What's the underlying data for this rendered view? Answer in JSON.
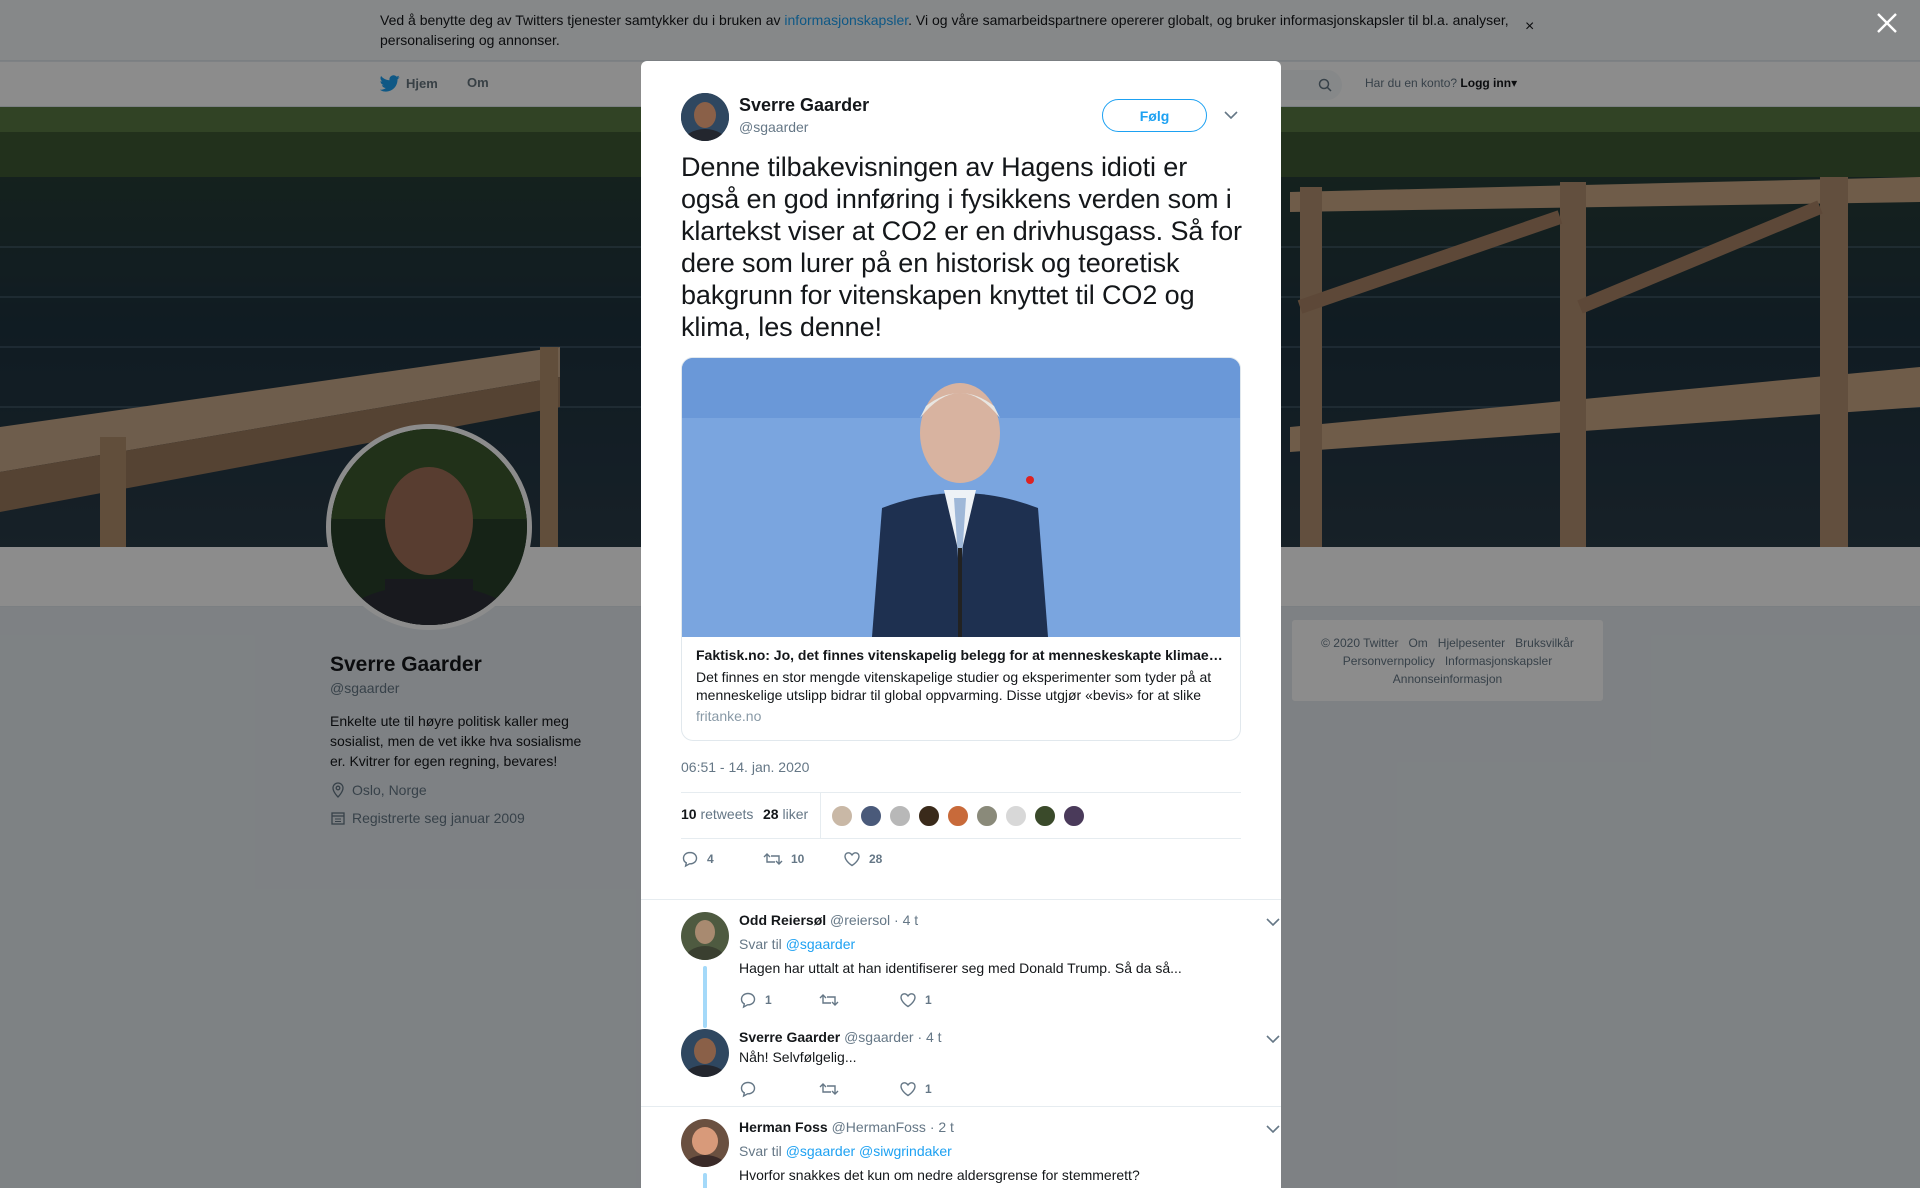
{
  "cookie_bar": {
    "text_before": "Ved å benytte deg av Twitters tjenester samtykker du i bruken av ",
    "link": "informasjonskapsler",
    "text_after": ". Vi og våre samarbeidspartnere opererer globalt, og bruker informasjonskapsler til bl.a. analyser, personalisering og annonser.",
    "close_icon": "×"
  },
  "nav": {
    "home": "Hjem",
    "about": "Om",
    "login_prompt": "Har du en konto?",
    "login": "Logg inn"
  },
  "profile": {
    "name": "Sverre Gaarder",
    "handle": "@sgaarder",
    "bio": "Enkelte ute til høyre politisk kaller meg sosialist, men de vet ikke hva sosialisme er. Kvitrer for egen regning, bevares!",
    "location": "Oslo, Norge",
    "joined": "Registrerte seg januar 2009"
  },
  "footer": {
    "links": [
      "© 2020 Twitter",
      "Om",
      "Hjelpesenter",
      "Bruksvilkår",
      "Personvernpolicy",
      "Informasjonskapsler",
      "Annonseinformasjon"
    ]
  },
  "tweet": {
    "author_name": "Sverre Gaarder",
    "author_handle": "@sgaarder",
    "follow_label": "Følg",
    "text": "Denne tilbakevisningen av Hagens idioti er også en god innføring i fysikkens verden som i klartekst viser at CO2 er en drivhusgass. Så for dere som lurer på en historisk og teoretisk bakgrunn for vitenskapen knyttet til CO2 og klima, les denne!",
    "card": {
      "title": "Faktisk.no: Jo, det finnes vitenskapelig belegg for at menneskeskapte klimaendringer",
      "description": "Det finnes en stor mengde vitenskapelige studier og eksperimenter som tyder på at menneskelige utslipp bidrar til global oppvarming. Disse utgjør «bevis» for at slike",
      "domain": "fritanke.no"
    },
    "timestamp": "06:51 - 14. jan. 2020",
    "retweets_count": "10",
    "retweets_label": "retweets",
    "likes_count": "28",
    "likes_label": "liker",
    "actions": {
      "replies": "4",
      "retweets": "10",
      "likes": "28"
    },
    "liker_colors": [
      "#c9b8a6",
      "#4a5a7a",
      "#b8b8b8",
      "#3a2a1a",
      "#c86a3a",
      "#8a8a7a",
      "#d8d8d8",
      "#3a4a2a",
      "#4a3a5a"
    ]
  },
  "replies": [
    {
      "name": "Odd Reiersøl",
      "handle": "@reiersol",
      "time": "· 4 t",
      "reply_to_label": "Svar til",
      "reply_to": "@sgaarder",
      "text": "Hagen har uttalt at han identifiserer seg med Donald Trump. Så da så...",
      "replies": "1",
      "retweets": "",
      "likes": "1"
    },
    {
      "name": "Sverre Gaarder",
      "handle": "@sgaarder",
      "time": "· 4 t",
      "text": "Nåh! Selvfølgelig...",
      "replies": "",
      "retweets": "",
      "likes": "1"
    },
    {
      "name": "Herman Foss",
      "handle": "@HermanFoss",
      "time": "· 2 t",
      "reply_to_label": "Svar til",
      "reply_to": "@sgaarder @siwgrindaker",
      "text": "Hvorfor snakkes det kun om nedre aldersgrense for stemmerett?"
    }
  ]
}
